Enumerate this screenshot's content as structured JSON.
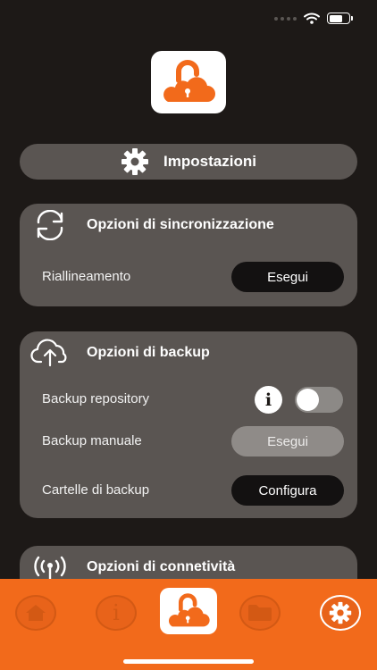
{
  "status_bar": {
    "wifi_icon": "wifi-icon",
    "battery_icon": "battery-icon"
  },
  "header": {
    "logo_icon": "cloud-lock-icon"
  },
  "settings": {
    "label": "Impostazioni",
    "icon": "gear-icon"
  },
  "sync_card": {
    "title": "Opzioni di sincronizzazione",
    "icon": "sync-arrows-icon",
    "rows": [
      {
        "label": "Riallineamento",
        "button": "Esegui"
      }
    ]
  },
  "backup_card": {
    "title": "Opzioni di backup",
    "icon": "cloud-upload-icon",
    "repository": {
      "label": "Backup repository",
      "info": "i",
      "toggle_on": false
    },
    "manual": {
      "label": "Backup manuale",
      "button": "Esegui"
    },
    "folders": {
      "label": "Cartelle di backup",
      "button": "Configura"
    }
  },
  "conn_card": {
    "title": "Opzioni di connetività",
    "icon": "antenna-icon"
  },
  "tab_bar": {
    "tabs": [
      {
        "name": "home",
        "icon": "home-icon"
      },
      {
        "name": "info",
        "icon": "info-icon",
        "glyph": "i"
      },
      {
        "name": "center",
        "icon": "cloud-lock-icon"
      },
      {
        "name": "folder",
        "icon": "folder-icon"
      },
      {
        "name": "settings",
        "icon": "gear-icon",
        "active": true
      }
    ]
  },
  "colors": {
    "accent": "#f26a1b",
    "background": "#1d1917",
    "card": "#5a5552"
  }
}
